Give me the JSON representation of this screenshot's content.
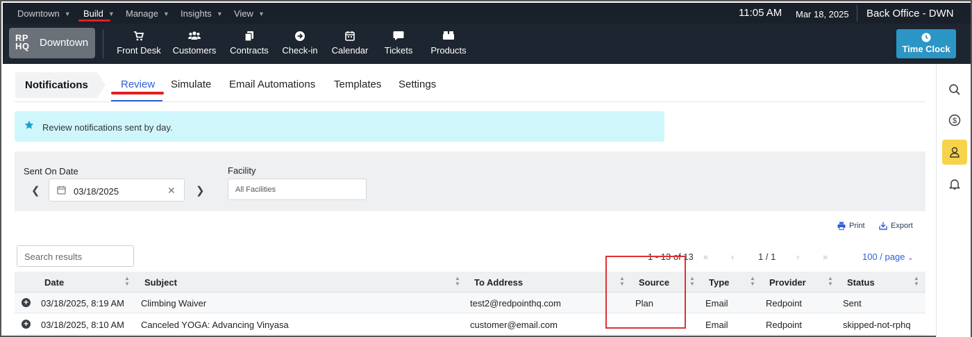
{
  "topbar": {
    "menus": [
      {
        "label": "Downtown"
      },
      {
        "label": "Build"
      },
      {
        "label": "Manage"
      },
      {
        "label": "Insights"
      },
      {
        "label": "View"
      }
    ],
    "active_menu": "Build",
    "time": "11:05 AM",
    "date": "Mar 18, 2025",
    "office": "Back Office - DWN"
  },
  "navbar": {
    "logo_text": "RP HQ",
    "logo_line1": "RP",
    "logo_line2": "HQ",
    "location": "Downtown",
    "items": [
      {
        "label": "Front Desk",
        "icon": "cart-icon"
      },
      {
        "label": "Customers",
        "icon": "users-icon"
      },
      {
        "label": "Contracts",
        "icon": "copy-icon"
      },
      {
        "label": "Check-in",
        "icon": "arrow-circle-icon"
      },
      {
        "label": "Calendar",
        "icon": "calendar-icon"
      },
      {
        "label": "Tickets",
        "icon": "comment-icon"
      },
      {
        "label": "Products",
        "icon": "boxes-icon"
      }
    ],
    "time_clock_label": "Time Clock"
  },
  "rail": {
    "icons": [
      "search-icon",
      "dollar-icon",
      "user-icon",
      "bell-icon"
    ],
    "active_icon": "user-icon",
    "active_color": "#f6d34a"
  },
  "tabs": {
    "section_title": "Notifications",
    "items": [
      "Review",
      "Simulate",
      "Email Automations",
      "Templates",
      "Settings"
    ],
    "active": "Review"
  },
  "alert": {
    "text": "Review notifications sent by day."
  },
  "filters": {
    "sent_on_label": "Sent On Date",
    "sent_on_value": "03/18/2025",
    "facility_label": "Facility",
    "facility_placeholder": "All Facilities"
  },
  "actions": {
    "print": "Print",
    "export": "Export"
  },
  "table": {
    "search_placeholder": "Search results",
    "range_text": "1 - 13 of 13",
    "page_text": "1 / 1",
    "page_size": "100 / page",
    "columns": [
      "Date",
      "Subject",
      "To Address",
      "Source",
      "Type",
      "Provider",
      "Status"
    ],
    "rows": [
      {
        "date": "03/18/2025, 8:19 AM",
        "subject": "Climbing Waiver",
        "to": "test2@redpointhq.com",
        "source": "Plan",
        "type": "Email",
        "provider": "Redpoint",
        "status": "Sent"
      },
      {
        "date": "03/18/2025, 8:10 AM",
        "subject": "Canceled YOGA: Advancing Vinyasa",
        "to": "customer@email.com",
        "source": "",
        "type": "Email",
        "provider": "Redpoint",
        "status": "skipped-not-rphq"
      }
    ]
  },
  "colors": {
    "topbar_bg": "#19202a",
    "accent": "#2e5fd8",
    "time_clock_bg": "#2b95c5",
    "alert_bg": "#cff7fb",
    "annotation": "#e03030"
  }
}
